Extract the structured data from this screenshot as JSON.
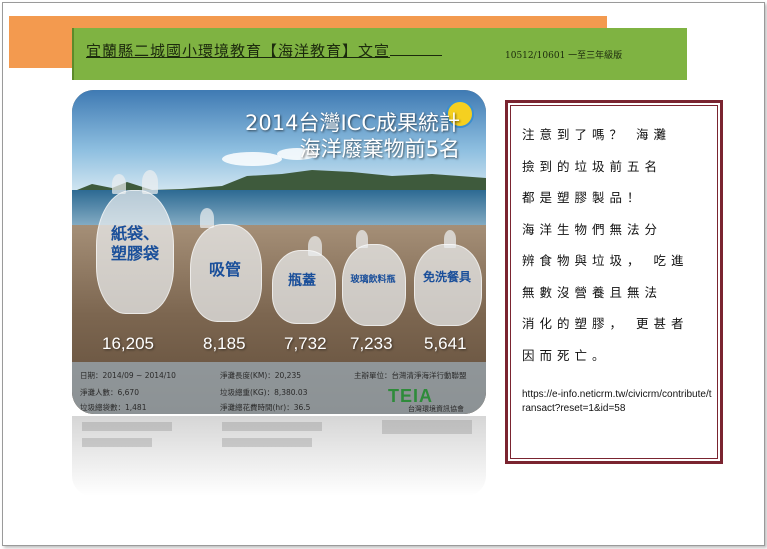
{
  "header": {
    "title": "宜蘭縣二城國小環境教育【海洋教育】文宣",
    "date_grade": "10512/10601 一至三年級版"
  },
  "infographic": {
    "title_line1": "2014台灣ICC成果統計",
    "title_line2": "海洋廢棄物前5名",
    "items": [
      {
        "label_line1": "紙袋、",
        "label_line2": "塑膠袋",
        "count": "16,205"
      },
      {
        "label_line1": "吸管",
        "label_line2": "",
        "count": "8,185"
      },
      {
        "label_line1": "瓶蓋",
        "label_line2": "",
        "count": "7,732"
      },
      {
        "label_line1": "玻璃飲料瓶",
        "label_line2": "",
        "count": "7,233"
      },
      {
        "label_line1": "免洗餐具",
        "label_line2": "",
        "count": "5,641"
      }
    ],
    "stats": {
      "date": "日期：2014/09 ~ 2014/10",
      "people": "淨灘人數：6,670",
      "bags": "垃圾總袋數：1,481",
      "length": "淨灘長度(KM)：20,235",
      "weight": "垃圾總重(KG)：8,380.03",
      "hours": "淨灘總花費時間(hr)：36.5",
      "organizer": "主辦單位：台灣清淨海洋行動聯盟"
    },
    "logo_text": "TEIA",
    "logo_sub": "台灣環境資訊協會"
  },
  "note": {
    "line1": "注意到了嗎？ 海灘",
    "line2": "撿到的垃圾前五名",
    "line3": "都是塑膠製品！",
    "line4": "海洋生物們無法分",
    "line5": "辨食物與垃圾， 吃進",
    "line6": "無數沒營養且無法",
    "line7": "消化的塑膠， 更甚者",
    "line8": "因而死亡。",
    "url": "https://e-info.neticrm.tw/civicrm/contribute/transact?reset=1&id=58"
  }
}
